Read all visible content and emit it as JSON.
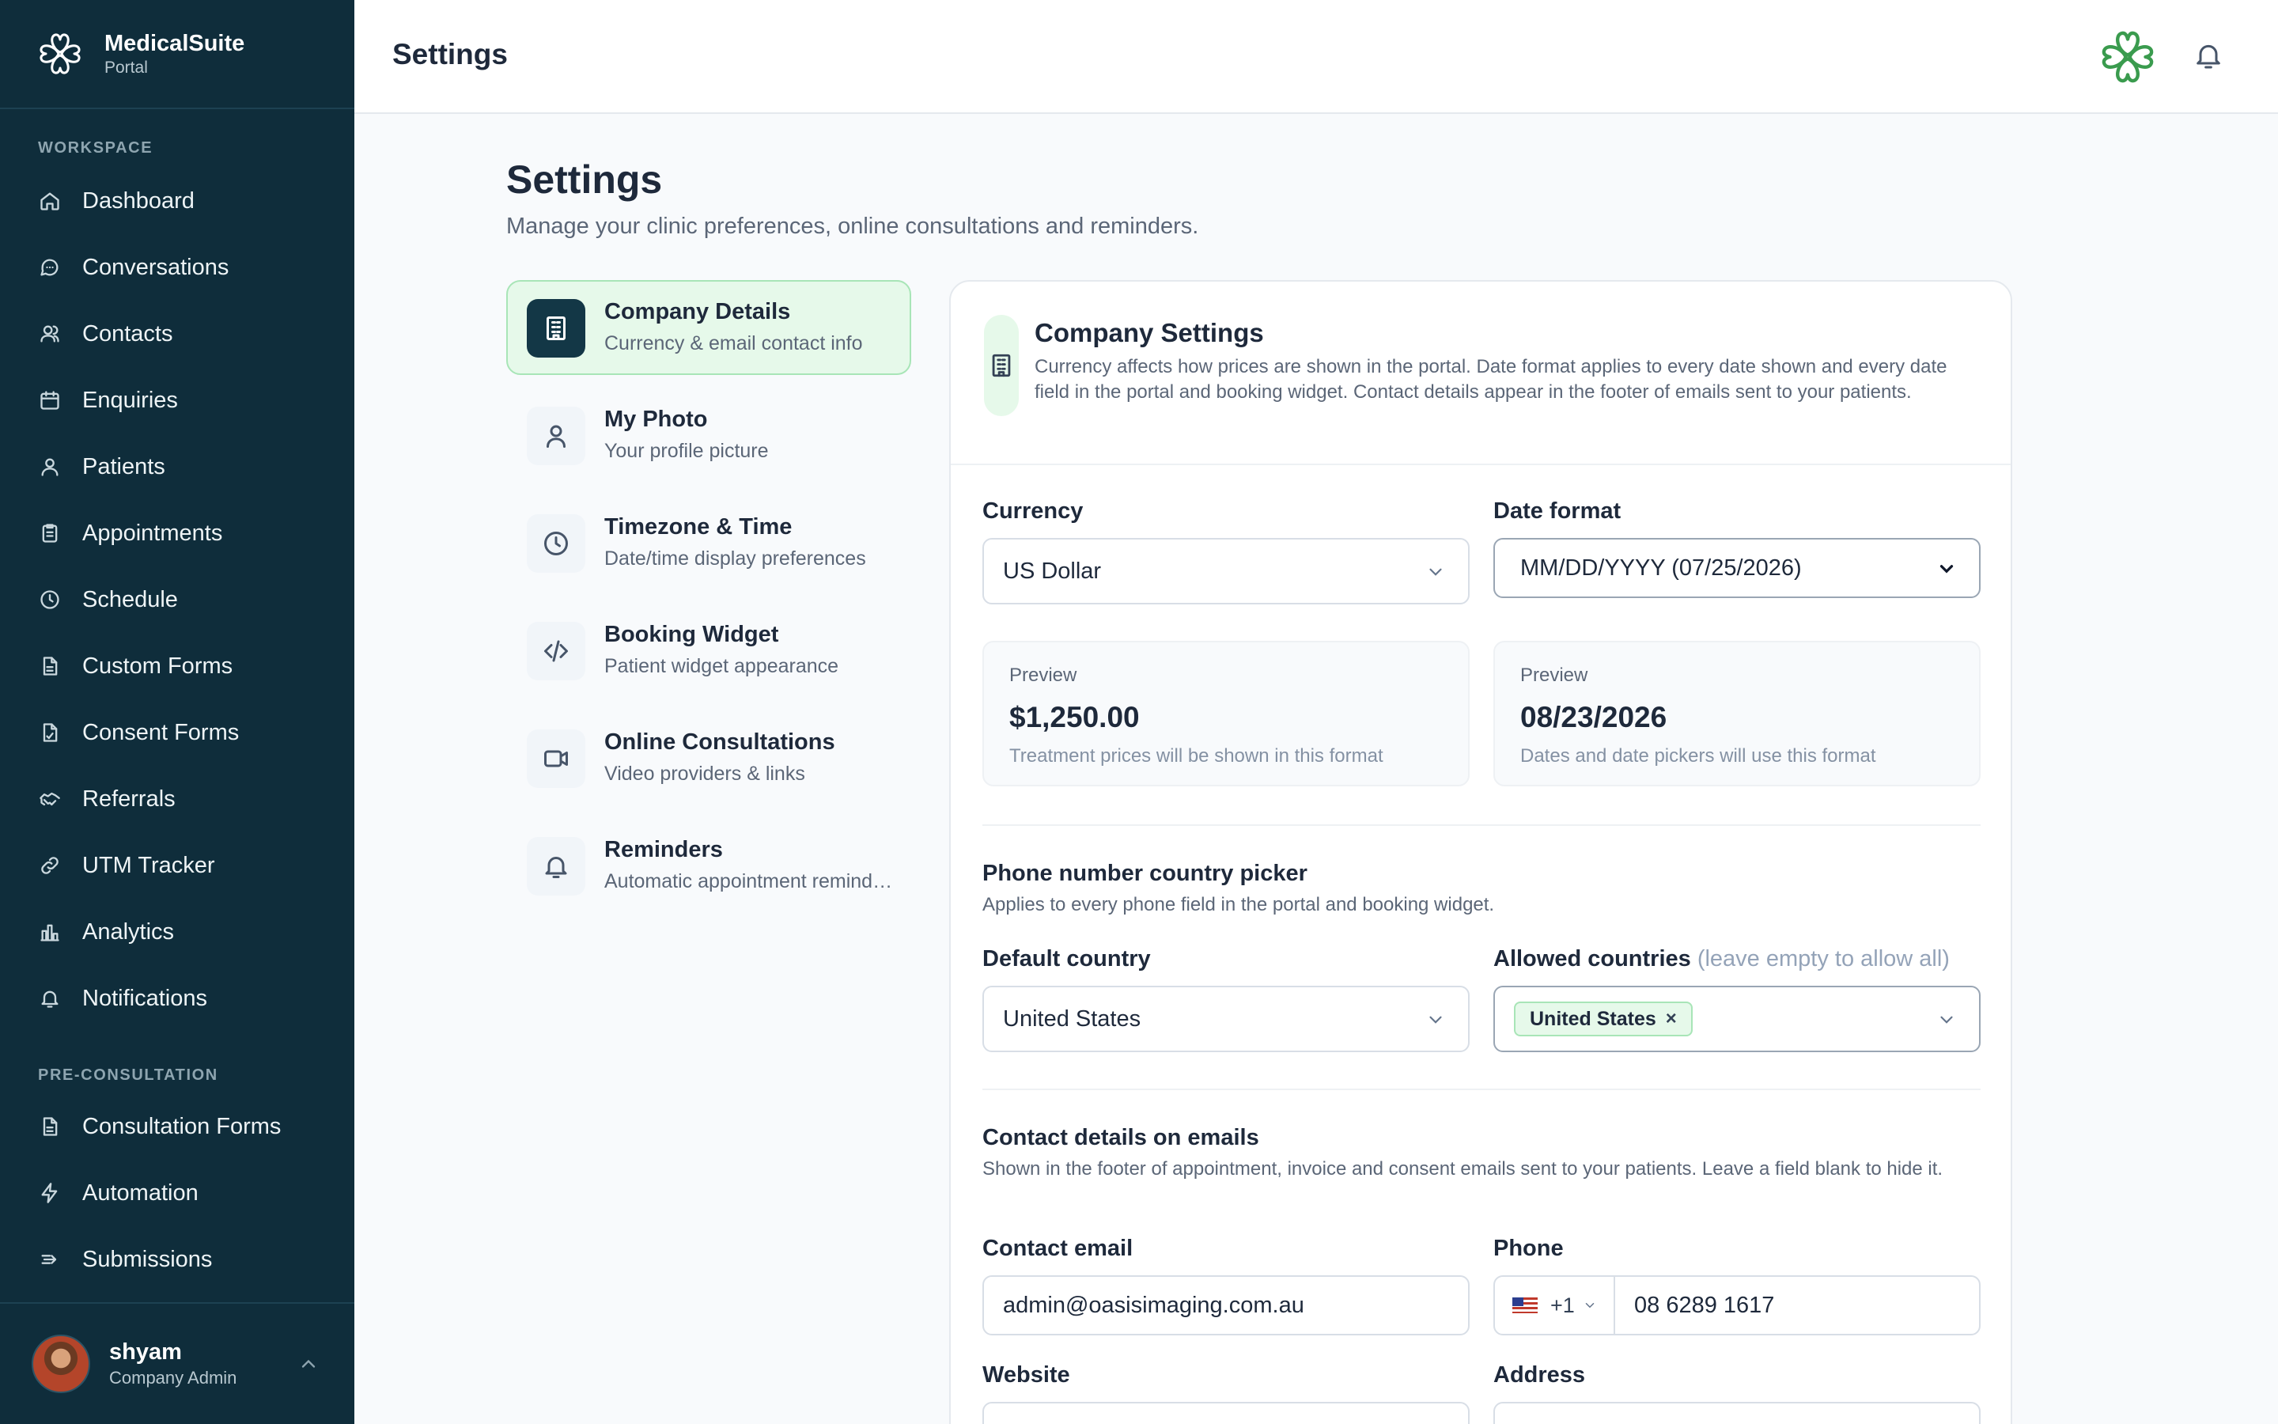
{
  "app": {
    "name": "MedicalSuite",
    "subtitle": "Portal",
    "brand_color": "#0f2d3b",
    "accent_color": "#3a9b4e"
  },
  "sidebar": {
    "sections": [
      {
        "label": "WORKSPACE",
        "items": [
          {
            "label": "Dashboard",
            "icon": "home-icon"
          },
          {
            "label": "Conversations",
            "icon": "chat-bubble-icon"
          },
          {
            "label": "Contacts",
            "icon": "users-icon"
          },
          {
            "label": "Enquiries",
            "icon": "calendar-icon"
          },
          {
            "label": "Patients",
            "icon": "user-icon"
          },
          {
            "label": "Appointments",
            "icon": "clipboard-icon"
          },
          {
            "label": "Schedule",
            "icon": "clock-icon"
          },
          {
            "label": "Custom Forms",
            "icon": "document-icon"
          },
          {
            "label": "Consent Forms",
            "icon": "signed-document-icon"
          },
          {
            "label": "Referrals",
            "icon": "handshake-icon"
          },
          {
            "label": "UTM Tracker",
            "icon": "link-icon"
          },
          {
            "label": "Analytics",
            "icon": "bar-chart-icon"
          },
          {
            "label": "Notifications",
            "icon": "bell-icon"
          }
        ]
      },
      {
        "label": "PRE-CONSULTATION",
        "items": [
          {
            "label": "Consultation Forms",
            "icon": "document-icon"
          },
          {
            "label": "Automation",
            "icon": "lightning-icon"
          },
          {
            "label": "Submissions",
            "icon": "submit-arrow-icon"
          }
        ]
      }
    ],
    "user": {
      "name": "shyam",
      "role": "Company Admin"
    }
  },
  "header": {
    "title": "Settings"
  },
  "main": {
    "title": "Settings",
    "subtitle": "Manage your clinic preferences, online consultations and reminders.",
    "settings_nav": [
      {
        "title": "Company Details",
        "subtitle": "Currency & email contact info",
        "icon": "building-icon",
        "active": true
      },
      {
        "title": "My Photo",
        "subtitle": "Your profile picture",
        "icon": "user-icon",
        "active": false
      },
      {
        "title": "Timezone & Time",
        "subtitle": "Date/time display preferences",
        "icon": "clock-icon",
        "active": false
      },
      {
        "title": "Booking Widget",
        "subtitle": "Patient widget appearance",
        "icon": "code-icon",
        "active": false
      },
      {
        "title": "Online Consultations",
        "subtitle": "Video providers & links",
        "icon": "video-icon",
        "active": false
      },
      {
        "title": "Reminders",
        "subtitle": "Automatic appointment reminders",
        "icon": "bell-icon",
        "active": false
      }
    ],
    "card": {
      "title": "Company Settings",
      "description": "Currency affects how prices are shown in the portal. Date format applies to every date shown and every date field in the portal and booking widget. Contact details appear in the footer of emails sent to your patients.",
      "currency": {
        "label": "Currency",
        "value": "US Dollar",
        "preview_label": "Preview",
        "preview_value": "$1,250.00",
        "preview_note": "Treatment prices will be shown in this format"
      },
      "date_format": {
        "label": "Date format",
        "value": "MM/DD/YYYY (07/25/2026)",
        "preview_label": "Preview",
        "preview_value": "08/23/2026",
        "preview_note": "Dates and date pickers will use this format"
      },
      "phone_picker": {
        "title": "Phone number country picker",
        "description": "Applies to every phone field in the portal and booking widget.",
        "default_country_label": "Default country",
        "default_country_value": "United States",
        "allowed_label": "Allowed countries",
        "allowed_hint": "(leave empty to allow all)",
        "allowed_chips": [
          "United States"
        ],
        "chip_remove": "×"
      },
      "contact": {
        "title": "Contact details on emails",
        "description": "Shown in the footer of appointment, invoice and consent emails sent to your patients. Leave a field blank to hide it.",
        "email_label": "Contact email",
        "email_value": "admin@oasisimaging.com.au",
        "phone_label": "Phone",
        "phone_code": "+1",
        "phone_value": "08 6289 1617",
        "website_label": "Website",
        "address_label": "Address"
      }
    }
  }
}
